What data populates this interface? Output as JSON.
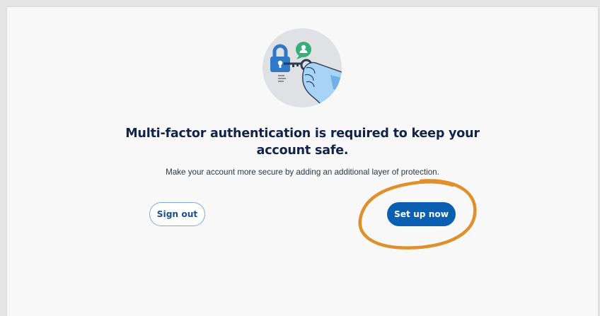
{
  "illustration": {
    "icon": "mfa-key-lock-illustration"
  },
  "headline": "Multi-factor authentication is required to keep your account safe.",
  "subtext": "Make your account more secure by adding an additional layer of protection.",
  "buttons": {
    "sign_out": "Sign out",
    "set_up": "Set up now"
  },
  "colors": {
    "primary": "#0b5fb0",
    "headline": "#12234a",
    "annotation": "#e0902a"
  }
}
